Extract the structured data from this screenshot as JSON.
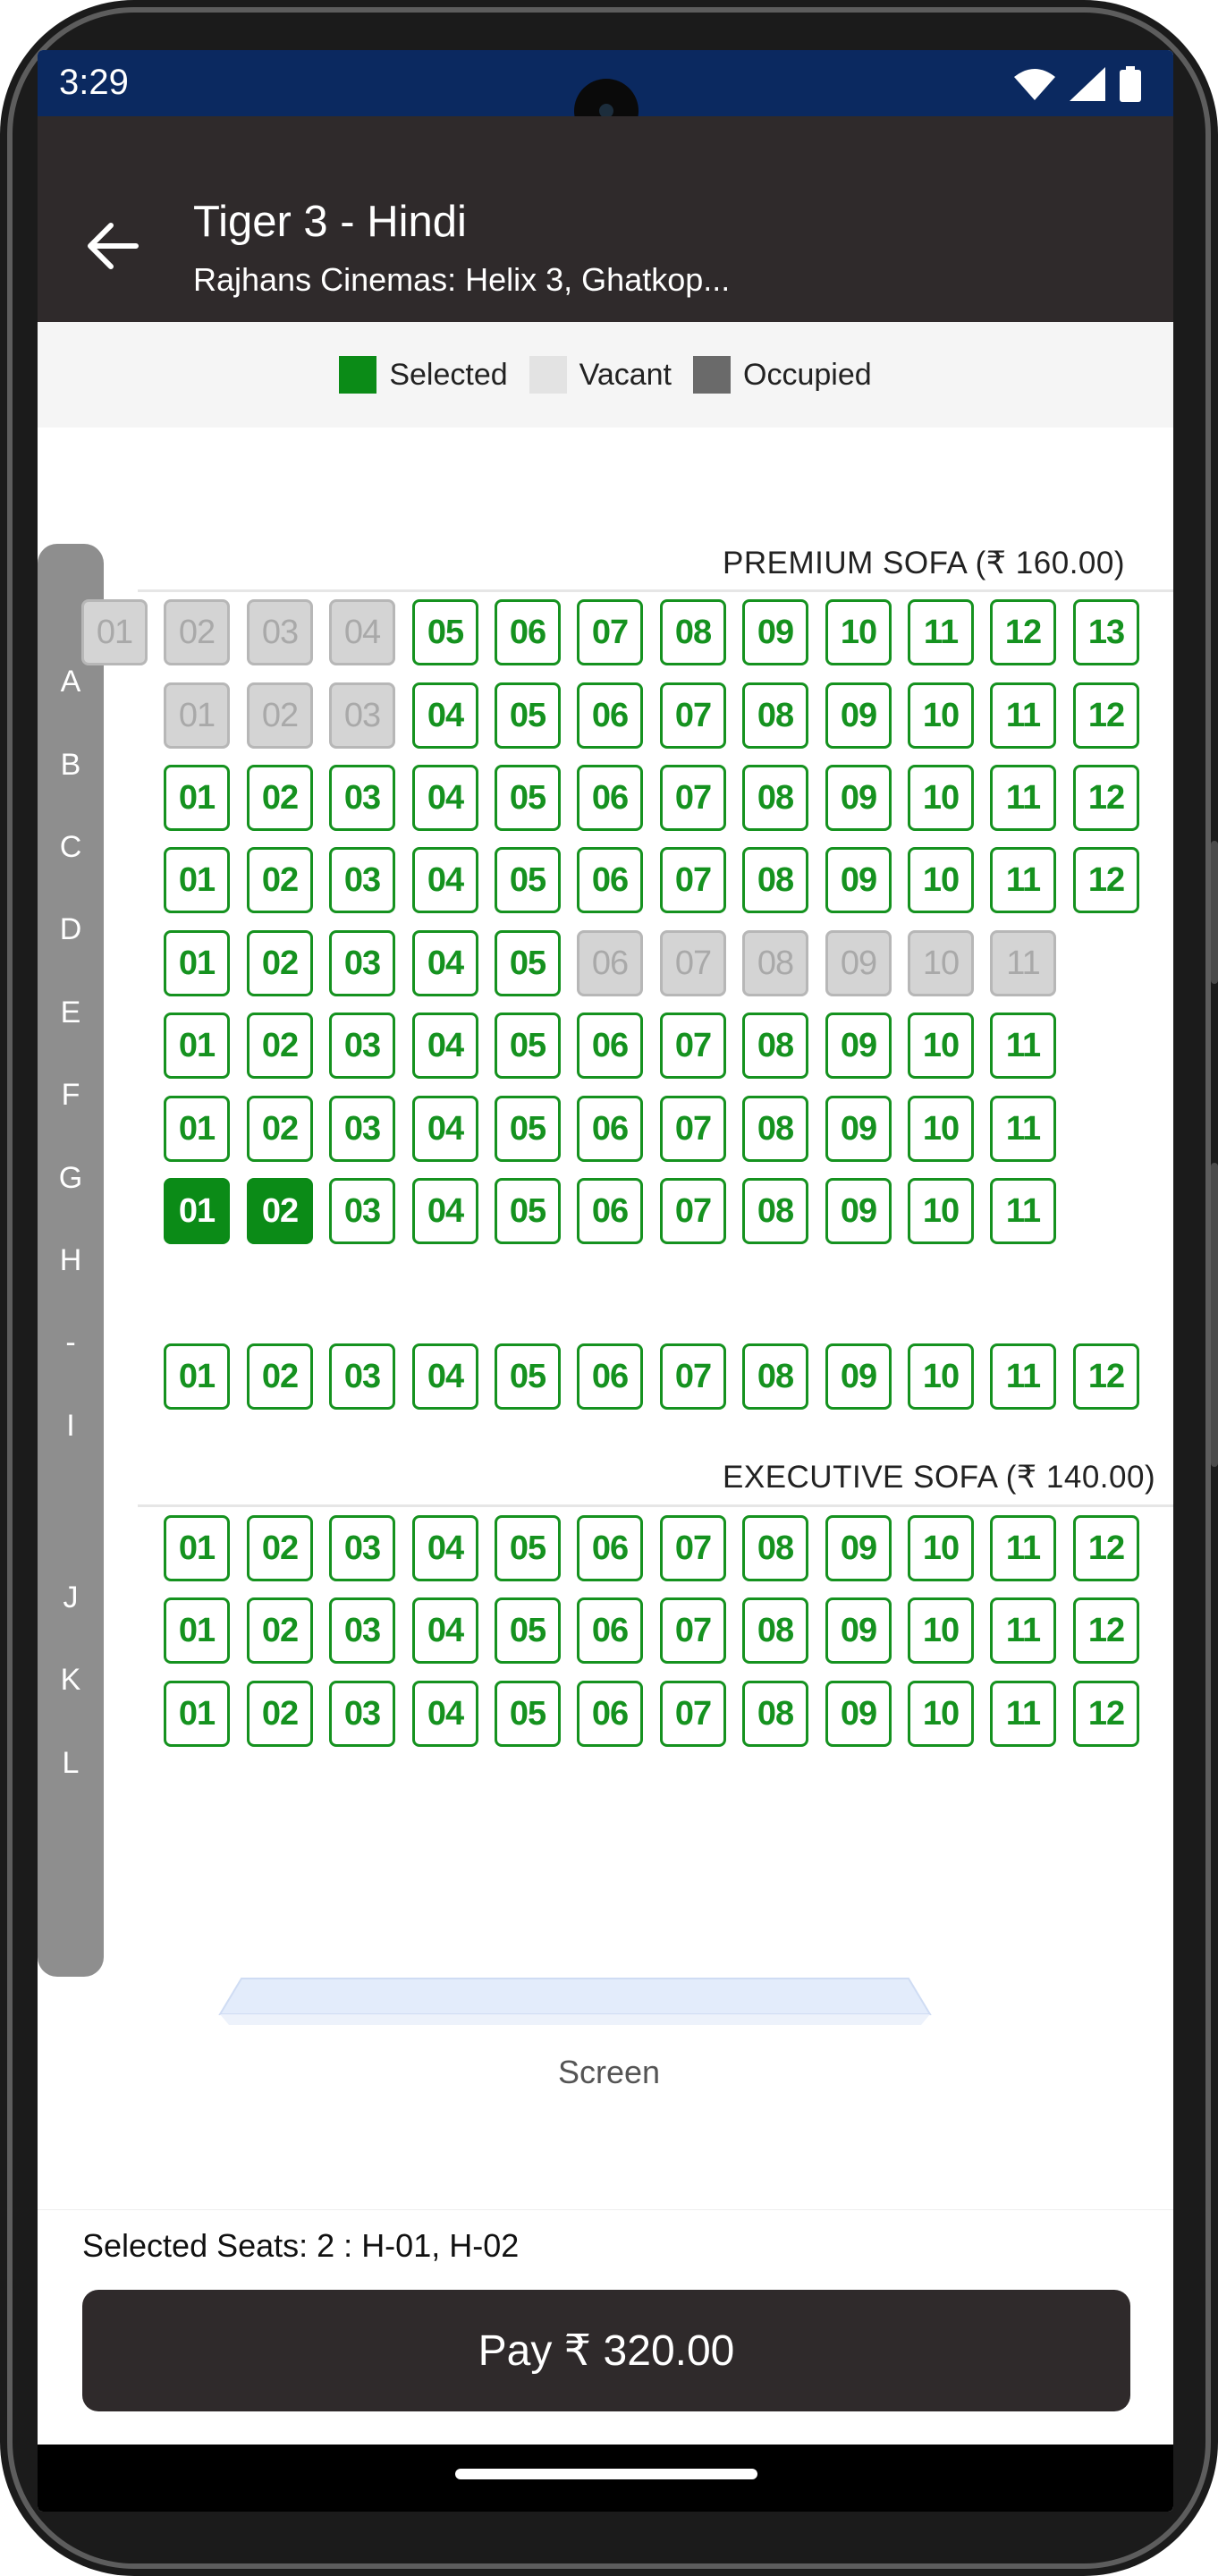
{
  "status_bar": {
    "time": "3:29"
  },
  "header": {
    "title": "Tiger 3 - Hindi",
    "subtitle": "Rajhans Cinemas: Helix 3, Ghatkop..."
  },
  "legend": {
    "selected": "Selected",
    "vacant": "Vacant",
    "occupied": "Occupied",
    "colors": {
      "selected": "#0b8b17",
      "vacant": "#e3e3e3",
      "occupied": "#6a6a6a"
    }
  },
  "row_labels": [
    "A",
    "B",
    "C",
    "D",
    "E",
    "F",
    "G",
    "H",
    "-",
    "I",
    "J",
    "K",
    "L"
  ],
  "sections": [
    {
      "title": "PREMIUM SOFA (₹ 160.00)"
    },
    {
      "title": "EXECUTIVE SOFA (₹ 140.00)"
    }
  ],
  "rows": [
    {
      "row": "A",
      "start_col": 0,
      "seats": [
        [
          "01",
          "occupied"
        ],
        [
          "02",
          "occupied"
        ],
        [
          "03",
          "occupied"
        ],
        [
          "04",
          "occupied"
        ],
        [
          "05",
          "vacant"
        ],
        [
          "06",
          "vacant"
        ],
        [
          "07",
          "vacant"
        ],
        [
          "08",
          "vacant"
        ],
        [
          "09",
          "vacant"
        ],
        [
          "10",
          "vacant"
        ],
        [
          "11",
          "vacant"
        ],
        [
          "12",
          "vacant"
        ],
        [
          "13",
          "vacant"
        ]
      ]
    },
    {
      "row": "B",
      "start_col": 1,
      "seats": [
        [
          "01",
          "occupied"
        ],
        [
          "02",
          "occupied"
        ],
        [
          "03",
          "occupied"
        ],
        [
          "04",
          "vacant"
        ],
        [
          "05",
          "vacant"
        ],
        [
          "06",
          "vacant"
        ],
        [
          "07",
          "vacant"
        ],
        [
          "08",
          "vacant"
        ],
        [
          "09",
          "vacant"
        ],
        [
          "10",
          "vacant"
        ],
        [
          "11",
          "vacant"
        ],
        [
          "12",
          "vacant"
        ]
      ]
    },
    {
      "row": "C",
      "start_col": 1,
      "seats": [
        [
          "01",
          "vacant"
        ],
        [
          "02",
          "vacant"
        ],
        [
          "03",
          "vacant"
        ],
        [
          "04",
          "vacant"
        ],
        [
          "05",
          "vacant"
        ],
        [
          "06",
          "vacant"
        ],
        [
          "07",
          "vacant"
        ],
        [
          "08",
          "vacant"
        ],
        [
          "09",
          "vacant"
        ],
        [
          "10",
          "vacant"
        ],
        [
          "11",
          "vacant"
        ],
        [
          "12",
          "vacant"
        ]
      ]
    },
    {
      "row": "D",
      "start_col": 1,
      "seats": [
        [
          "01",
          "vacant"
        ],
        [
          "02",
          "vacant"
        ],
        [
          "03",
          "vacant"
        ],
        [
          "04",
          "vacant"
        ],
        [
          "05",
          "vacant"
        ],
        [
          "06",
          "vacant"
        ],
        [
          "07",
          "vacant"
        ],
        [
          "08",
          "vacant"
        ],
        [
          "09",
          "vacant"
        ],
        [
          "10",
          "vacant"
        ],
        [
          "11",
          "vacant"
        ],
        [
          "12",
          "vacant"
        ]
      ]
    },
    {
      "row": "E",
      "start_col": 1,
      "seats": [
        [
          "01",
          "vacant"
        ],
        [
          "02",
          "vacant"
        ],
        [
          "03",
          "vacant"
        ],
        [
          "04",
          "vacant"
        ],
        [
          "05",
          "vacant"
        ],
        [
          "06",
          "occupied"
        ],
        [
          "07",
          "occupied"
        ],
        [
          "08",
          "occupied"
        ],
        [
          "09",
          "occupied"
        ],
        [
          "10",
          "occupied"
        ],
        [
          "11",
          "occupied"
        ]
      ]
    },
    {
      "row": "F",
      "start_col": 1,
      "seats": [
        [
          "01",
          "vacant"
        ],
        [
          "02",
          "vacant"
        ],
        [
          "03",
          "vacant"
        ],
        [
          "04",
          "vacant"
        ],
        [
          "05",
          "vacant"
        ],
        [
          "06",
          "vacant"
        ],
        [
          "07",
          "vacant"
        ],
        [
          "08",
          "vacant"
        ],
        [
          "09",
          "vacant"
        ],
        [
          "10",
          "vacant"
        ],
        [
          "11",
          "vacant"
        ]
      ]
    },
    {
      "row": "G",
      "start_col": 1,
      "seats": [
        [
          "01",
          "vacant"
        ],
        [
          "02",
          "vacant"
        ],
        [
          "03",
          "vacant"
        ],
        [
          "04",
          "vacant"
        ],
        [
          "05",
          "vacant"
        ],
        [
          "06",
          "vacant"
        ],
        [
          "07",
          "vacant"
        ],
        [
          "08",
          "vacant"
        ],
        [
          "09",
          "vacant"
        ],
        [
          "10",
          "vacant"
        ],
        [
          "11",
          "vacant"
        ]
      ]
    },
    {
      "row": "H",
      "start_col": 1,
      "seats": [
        [
          "01",
          "selected"
        ],
        [
          "02",
          "selected"
        ],
        [
          "03",
          "vacant"
        ],
        [
          "04",
          "vacant"
        ],
        [
          "05",
          "vacant"
        ],
        [
          "06",
          "vacant"
        ],
        [
          "07",
          "vacant"
        ],
        [
          "08",
          "vacant"
        ],
        [
          "09",
          "vacant"
        ],
        [
          "10",
          "vacant"
        ],
        [
          "11",
          "vacant"
        ]
      ]
    },
    {
      "row": "I",
      "start_col": 1,
      "seats": [
        [
          "01",
          "vacant"
        ],
        [
          "02",
          "vacant"
        ],
        [
          "03",
          "vacant"
        ],
        [
          "04",
          "vacant"
        ],
        [
          "05",
          "vacant"
        ],
        [
          "06",
          "vacant"
        ],
        [
          "07",
          "vacant"
        ],
        [
          "08",
          "vacant"
        ],
        [
          "09",
          "vacant"
        ],
        [
          "10",
          "vacant"
        ],
        [
          "11",
          "vacant"
        ],
        [
          "12",
          "vacant"
        ]
      ]
    },
    {
      "row": "J",
      "start_col": 1,
      "seats": [
        [
          "01",
          "vacant"
        ],
        [
          "02",
          "vacant"
        ],
        [
          "03",
          "vacant"
        ],
        [
          "04",
          "vacant"
        ],
        [
          "05",
          "vacant"
        ],
        [
          "06",
          "vacant"
        ],
        [
          "07",
          "vacant"
        ],
        [
          "08",
          "vacant"
        ],
        [
          "09",
          "vacant"
        ],
        [
          "10",
          "vacant"
        ],
        [
          "11",
          "vacant"
        ],
        [
          "12",
          "vacant"
        ]
      ]
    },
    {
      "row": "K",
      "start_col": 1,
      "seats": [
        [
          "01",
          "vacant"
        ],
        [
          "02",
          "vacant"
        ],
        [
          "03",
          "vacant"
        ],
        [
          "04",
          "vacant"
        ],
        [
          "05",
          "vacant"
        ],
        [
          "06",
          "vacant"
        ],
        [
          "07",
          "vacant"
        ],
        [
          "08",
          "vacant"
        ],
        [
          "09",
          "vacant"
        ],
        [
          "10",
          "vacant"
        ],
        [
          "11",
          "vacant"
        ],
        [
          "12",
          "vacant"
        ]
      ]
    },
    {
      "row": "L",
      "start_col": 1,
      "seats": [
        [
          "01",
          "vacant"
        ],
        [
          "02",
          "vacant"
        ],
        [
          "03",
          "vacant"
        ],
        [
          "04",
          "vacant"
        ],
        [
          "05",
          "vacant"
        ],
        [
          "06",
          "vacant"
        ],
        [
          "07",
          "vacant"
        ],
        [
          "08",
          "vacant"
        ],
        [
          "09",
          "vacant"
        ],
        [
          "10",
          "vacant"
        ],
        [
          "11",
          "vacant"
        ],
        [
          "12",
          "vacant"
        ]
      ]
    }
  ],
  "screen_label": "Screen",
  "footer": {
    "selected_seats": "Selected Seats: 2 : H-01, H-02",
    "pay_label": "Pay ₹ 320.00"
  }
}
